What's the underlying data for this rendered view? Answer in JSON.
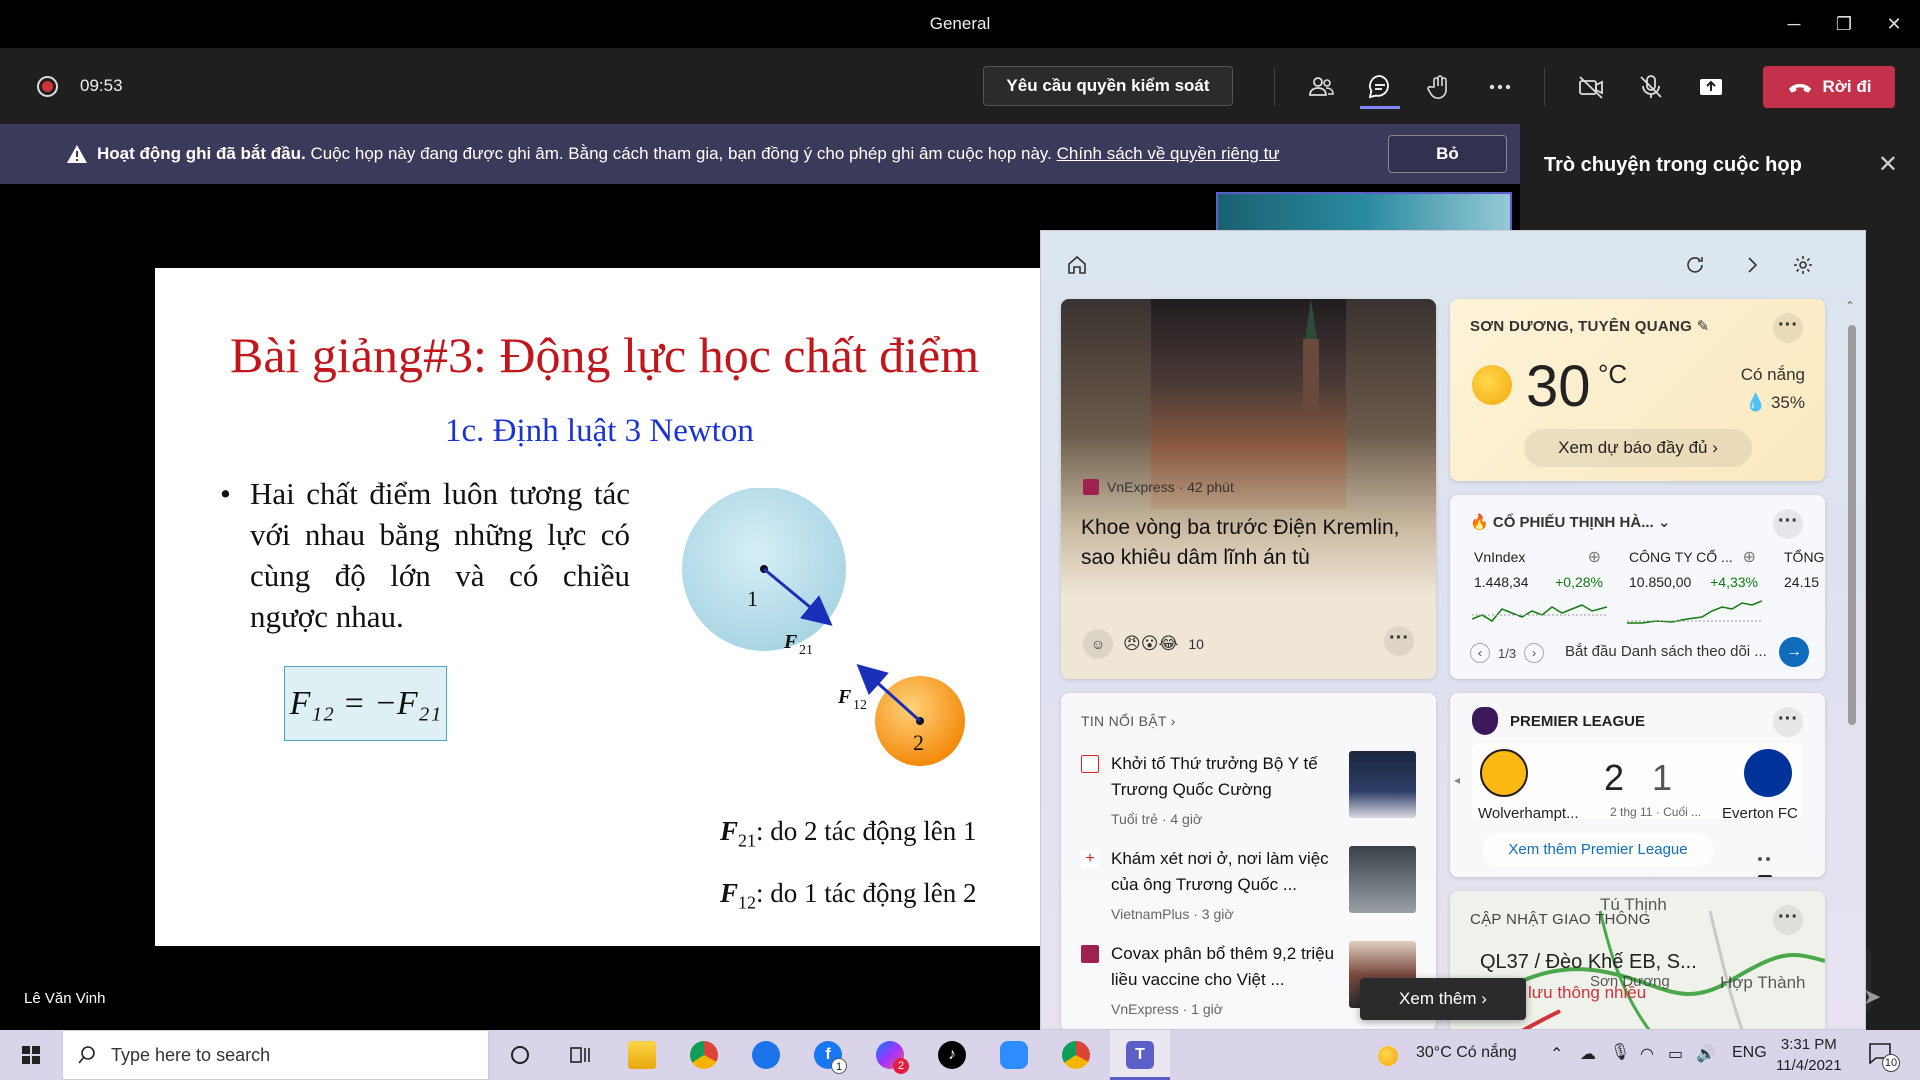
{
  "window": {
    "title": "General"
  },
  "meeting": {
    "timer": "09:53",
    "request_control": "Yêu cầu quyền kiểm soát",
    "leave_label": "Rời đi",
    "participant_name": "Lê Văn Vinh"
  },
  "banner": {
    "bold_text": "Hoạt động ghi đã bắt đầu.",
    "text": "Cuộc họp này đang được ghi âm. Bằng cách tham gia, bạn đồng ý cho phép ghi âm cuộc họp này.",
    "link": "Chính sách về quyền riêng tư",
    "dismiss": "Bỏ"
  },
  "chat": {
    "title": "Trò chuyện trong cuộc họp"
  },
  "slide": {
    "title": "Bài giảng#3: Động lực học chất điểm",
    "subtitle": "1c. Định luật 3 Newton",
    "body": "Hai chất điểm luôn tương tác với nhau bằng những lực có cùng độ lớn và có chiều ngược nhau.",
    "formula": "F₁₂ = −F₂₁",
    "labels": {
      "ball1": "1",
      "ball2": "2",
      "f21": "F",
      "f21_sub": "21",
      "f12": "F",
      "f12_sub": "12"
    },
    "note1": "do 2 tác động lên 1",
    "note2": "do 1 tác động lên 2",
    "note1_sym": "F",
    "note1_sub": "21",
    "note1_sep": ":",
    "note2_sym": "F",
    "note2_sub": "12",
    "note2_sep": ":"
  },
  "widgets": {
    "hero": {
      "source": "VnExpress · 42 phút",
      "headline": "Khoe vòng ba trước Điện Kremlin, sao khiêu dâm lĩnh án tù",
      "reactions_count": "10"
    },
    "weather": {
      "location": "SƠN DƯƠNG, TUYÊN QUANG",
      "temp": "30",
      "unit": "°C",
      "condition": "Có nắng",
      "humidity": "35%",
      "forecast_btn": "Xem dự báo đầy đủ"
    },
    "stocks": {
      "title": "CỔ PHIẾU THỊNH HÀ...",
      "items": [
        {
          "name": "VnIndex",
          "value": "1.448,34",
          "change": "+0,28%"
        },
        {
          "name": "CÔNG TY CỔ ...",
          "value": "10.850,00",
          "change": "+4,33%"
        },
        {
          "name": "TỔNG",
          "value": "24.15",
          "change": ""
        }
      ],
      "pager": "1/3",
      "watchlist": "Bắt đầu Danh sách theo dõi ..."
    },
    "stories": {
      "header": "TIN NỔI BẬT",
      "items": [
        {
          "title": "Khởi tố Thứ trưởng Bộ Y tế Trương Quốc Cường",
          "meta": "Tuổi trẻ · 4 giờ"
        },
        {
          "title": "Khám xét nơi ở, nơi làm việc của ông Trương Quốc ...",
          "meta": "VietnamPlus · 3 giờ"
        },
        {
          "title": "Covax phân bổ thêm 9,2 triệu liều vaccine cho Việt ...",
          "meta": "VnExpress · 1 giờ"
        }
      ]
    },
    "premier_league": {
      "title": "PREMIER LEAGUE",
      "home": "Wolverhampt...",
      "away": "Everton FC",
      "home_score": "2",
      "away_score": "1",
      "info": "2 thg 11 · Cuối ...",
      "more_btn": "Xem thêm Premier League"
    },
    "traffic": {
      "header": "CẬP NHẬT GIAO THÔNG",
      "road": "QL37 / Đèo Khế EB, S...",
      "state": "lưu thông nhiều",
      "places": [
        "Tú Thịnh",
        "Sơn Dương",
        "Hợp Thành"
      ]
    },
    "see_more": "Xem thêm"
  },
  "taskbar": {
    "search_placeholder": "Type here to search",
    "weather": "30°C  Có nắng",
    "lang": "ENG",
    "time": "3:31 PM",
    "date": "11/4/2021",
    "notifications": "10"
  }
}
